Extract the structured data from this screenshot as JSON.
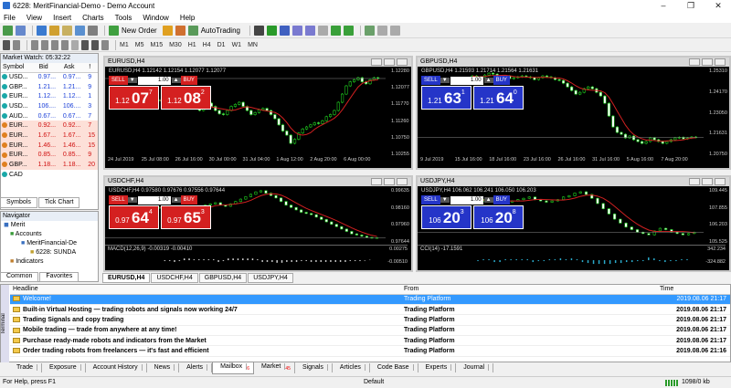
{
  "window": {
    "title": "6228: MeritFinancial-Demo - Demo Account"
  },
  "menu": [
    "File",
    "View",
    "Insert",
    "Charts",
    "Tools",
    "Window",
    "Help"
  ],
  "toolbar": {
    "new_order": "New Order",
    "autotrading": "AutoTrading"
  },
  "timeframes": [
    "M1",
    "M5",
    "M15",
    "M30",
    "H1",
    "H4",
    "D1",
    "W1",
    "MN"
  ],
  "market_watch": {
    "title": "Market Watch: 05:32:22",
    "columns": [
      "Symbol",
      "Bid",
      "Ask",
      "!"
    ],
    "rows": [
      {
        "symbol": "USD...",
        "bid": "0.97...",
        "ask": "0.97...",
        "spread": "9",
        "dot": "#1aa8a8",
        "bg": "#ffffff",
        "col": "#1a3fd8"
      },
      {
        "symbol": "GBP...",
        "bid": "1.21...",
        "ask": "1.21...",
        "spread": "9",
        "dot": "#1aa8a8",
        "bg": "#ffffff",
        "col": "#1a3fd8"
      },
      {
        "symbol": "EUR...",
        "bid": "1.12...",
        "ask": "1.12...",
        "spread": "1",
        "dot": "#1aa8a8",
        "bg": "#ffffff",
        "col": "#1a3fd8"
      },
      {
        "symbol": "USD...",
        "bid": "106....",
        "ask": "106....",
        "spread": "3",
        "dot": "#1aa8a8",
        "bg": "#ffffff",
        "col": "#1a3fd8"
      },
      {
        "symbol": "AUD...",
        "bid": "0.67...",
        "ask": "0.67...",
        "spread": "7",
        "dot": "#1aa8a8",
        "bg": "#ffffff",
        "col": "#1a3fd8"
      },
      {
        "symbol": "EUR...",
        "bid": "0.92...",
        "ask": "0.92...",
        "spread": "7",
        "dot": "#e08020",
        "bg": "#fde0d8",
        "col": "#d01010"
      },
      {
        "symbol": "EUR...",
        "bid": "1.67...",
        "ask": "1.67...",
        "spread": "15",
        "dot": "#e08020",
        "bg": "#fde0d8",
        "col": "#d01010"
      },
      {
        "symbol": "EUR...",
        "bid": "1.46...",
        "ask": "1.46...",
        "spread": "15",
        "dot": "#e08020",
        "bg": "#fde0d8",
        "col": "#d01010"
      },
      {
        "symbol": "EUR...",
        "bid": "0.85...",
        "ask": "0.85...",
        "spread": "9",
        "dot": "#e08020",
        "bg": "#fde0d8",
        "col": "#d01010"
      },
      {
        "symbol": "GBP...",
        "bid": "1.18...",
        "ask": "1.18...",
        "spread": "20",
        "dot": "#e08020",
        "bg": "#fde0d8",
        "col": "#d01010"
      },
      {
        "symbol": "CAD",
        "bid": "",
        "ask": "",
        "spread": "",
        "dot": "#1aa8a8",
        "bg": "#ffffff",
        "col": "#1a3fd8"
      }
    ],
    "tabs": [
      "Symbols",
      "Tick Chart"
    ]
  },
  "navigator": {
    "title": "Navigator",
    "items": [
      "Merit",
      "Accounts",
      "MeritFinancial-De",
      "6228: SUNDA",
      "Indicators"
    ],
    "tabs": [
      "Common",
      "Favorites"
    ]
  },
  "charts": [
    {
      "id": "eurusd",
      "title": "EURUSD,H4",
      "info": "EURUSD,H4  1.12142 1.12154 1.12077 1.12077",
      "sell_big": "07",
      "sell_pre": "1.12",
      "sell_sup": "7",
      "buy_big": "08",
      "buy_pre": "1.12",
      "buy_sup": "2",
      "lot": "1.00",
      "accent": "#d42020",
      "sell": "SELL",
      "buy": "BUY",
      "yticks": [
        "1.12280",
        "1.12077",
        "1.11770",
        "1.11260",
        "1.10750",
        "1.10255"
      ],
      "xticks": [
        "24 Jul 2019",
        "25 Jul 08:00",
        "26 Jul 16:00",
        "30 Jul 00:00",
        "31 Jul 04:00",
        "1 Aug 12:00",
        "2 Aug 20:00",
        "6 Aug 00:00"
      ],
      "close": [
        1.1155,
        1.115,
        1.1147,
        1.114,
        1.1145,
        1.1142,
        1.115,
        1.1145,
        1.1138,
        1.1135,
        1.113,
        1.114,
        1.1148,
        1.114,
        1.113,
        1.1122,
        1.112,
        1.113,
        1.114,
        1.1145,
        1.115,
        1.114,
        1.113,
        1.112,
        1.1125,
        1.1132,
        1.1135,
        1.113,
        1.112,
        1.111,
        1.1095,
        1.108,
        1.107,
        1.105,
        1.106,
        1.1075,
        1.1085,
        1.109,
        1.1095,
        1.11,
        1.1098,
        1.1105,
        1.1115,
        1.112,
        1.113,
        1.115,
        1.117,
        1.119,
        1.12,
        1.1205,
        1.121,
        1.12,
        1.1195,
        1.1205,
        1.121,
        1.1208
      ],
      "ylim": [
        1.10255,
        1.1228
      ]
    },
    {
      "id": "gbpusd",
      "title": "GBPUSD,H4",
      "info": "GBPUSD,H4  1.21593 1.21714 1.21564 1.21631",
      "sell_big": "63",
      "sell_pre": "1.21",
      "sell_sup": "1",
      "buy_big": "64",
      "buy_pre": "1.21",
      "buy_sup": "0",
      "lot": "1.00",
      "accent": "#2535c8",
      "sell": "SELL",
      "buy": "BUY",
      "yticks": [
        "1.25310",
        "1.24170",
        "1.23050",
        "1.21631",
        "1.20750"
      ],
      "xticks": [
        "9 Jul 2019",
        "15 Jul 16:00",
        "18 Jul 16:00",
        "23 Jul 16:00",
        "26 Jul 16:00",
        "31 Jul 16:00",
        "5 Aug 16:00",
        "7 Aug 20:00"
      ],
      "close": [
        1.25,
        1.249,
        1.2495,
        1.2505,
        1.2515,
        1.251,
        1.25,
        1.2495,
        1.25,
        1.2485,
        1.249,
        1.2495,
        1.25,
        1.2495,
        1.249,
        1.248,
        1.249,
        1.25,
        1.2495,
        1.249,
        1.248,
        1.2475,
        1.246,
        1.244,
        1.242,
        1.24,
        1.241,
        1.243,
        1.244,
        1.243,
        1.241,
        1.239,
        1.235,
        1.228,
        1.222,
        1.219,
        1.218,
        1.216,
        1.217,
        1.215,
        1.214,
        1.213,
        1.214,
        1.216,
        1.215,
        1.214,
        1.213,
        1.214,
        1.215,
        1.216,
        1.2163,
        1.2155,
        1.216,
        1.2165,
        1.2163
      ],
      "ylim": [
        1.2075,
        1.2531
      ]
    },
    {
      "id": "usdchf",
      "title": "USDCHF,H4",
      "info": "USDCHF,H4  0.97580 0.97676 0.97556 0.97644",
      "sell_big": "64",
      "sell_pre": "0.97",
      "sell_sup": "4",
      "buy_big": "65",
      "buy_pre": "0.97",
      "buy_sup": "3",
      "lot": "1.00",
      "accent": "#d42020",
      "sell": "SELL",
      "buy": "BUY",
      "ind": "MACD(12,26,9)  -0.00319 -0.00410",
      "yticks": [
        "0.99635",
        "0.98160",
        "0.97960",
        "0.97644"
      ],
      "xticks": [],
      "close": [
        0.989,
        0.9885,
        0.988,
        0.987,
        0.9865,
        0.9875,
        0.9885,
        0.989,
        0.9895,
        0.99,
        0.9905,
        0.991,
        0.99,
        0.9895,
        0.9905,
        0.9915,
        0.9925,
        0.9935,
        0.9945,
        0.9955,
        0.996,
        0.995,
        0.994,
        0.993,
        0.9915,
        0.99,
        0.989,
        0.988,
        0.987,
        0.9865,
        0.986,
        0.985,
        0.984,
        0.983,
        0.982,
        0.981,
        0.98,
        0.979,
        0.978,
        0.9775,
        0.977,
        0.9765,
        0.9762,
        0.9764
      ],
      "ylim": [
        0.975,
        0.99635
      ],
      "ind_ticks": [
        "0.00275",
        "-0.00510"
      ]
    },
    {
      "id": "usdjpy",
      "title": "USDJPY,H4",
      "info": "USDJPY,H4  106.062 106.241 106.050 106.203",
      "sell_big": "20",
      "sell_pre": "106",
      "sell_sup": "3",
      "buy_big": "20",
      "buy_pre": "106",
      "buy_sup": "8",
      "lot": "1.00",
      "accent": "#2535c8",
      "sell": "SELL",
      "buy": "BUY",
      "ind": "CCI(14)  -17.1591",
      "yticks": [
        "109.445",
        "107.855",
        "106.203",
        "105.525"
      ],
      "xticks": [],
      "close": [
        108.7,
        108.6,
        108.7,
        108.8,
        108.6,
        108.4,
        108.5,
        108.6,
        108.7,
        108.8,
        108.9,
        108.7,
        108.6,
        108.5,
        108.6,
        108.7,
        108.9,
        109.0,
        109.2,
        109.3,
        109.1,
        108.8,
        108.4,
        108.0,
        107.6,
        107.2,
        106.9,
        106.6,
        106.4,
        106.2,
        106.1,
        106.0,
        106.3,
        106.5,
        106.4,
        106.2,
        106.1,
        106.0,
        106.1,
        106.2
      ],
      "ylim": [
        105.525,
        109.445
      ],
      "ind_ticks": [
        "342.234",
        "-324.882"
      ]
    }
  ],
  "chart_tabs": [
    "EURUSD,H4",
    "USDCHF,H4",
    "GBPUSD,H4",
    "USDJPY,H4"
  ],
  "terminal": {
    "label": "Terminal",
    "columns": [
      "Headline",
      "From",
      "Time"
    ],
    "rows": [
      {
        "headline": "Welcome!",
        "from": "Trading Platform",
        "time": "2019.08.06 21:17",
        "bold": false,
        "sel": true
      },
      {
        "headline": "Built-in Virtual Hosting — trading robots and signals now working 24/7",
        "from": "Trading Platform",
        "time": "2019.08.06 21:17",
        "bold": true,
        "sel": false
      },
      {
        "headline": "Trading Signals and copy trading",
        "from": "Trading Platform",
        "time": "2019.08.06 21:17",
        "bold": true,
        "sel": false
      },
      {
        "headline": "Mobile trading — trade from anywhere at any time!",
        "from": "Trading Platform",
        "time": "2019.08.06 21:17",
        "bold": true,
        "sel": false
      },
      {
        "headline": "Purchase ready-made robots and indicators from the Market",
        "from": "Trading Platform",
        "time": "2019.08.06 21:17",
        "bold": true,
        "sel": false
      },
      {
        "headline": "Order trading robots from freelancers — it's fast and efficient",
        "from": "Trading Platform",
        "time": "2019.08.06 21:16",
        "bold": true,
        "sel": false
      }
    ],
    "tabs": [
      {
        "label": "Trade",
        "sub": ""
      },
      {
        "label": "Exposure",
        "sub": ""
      },
      {
        "label": "Account History",
        "sub": ""
      },
      {
        "label": "News",
        "sub": ""
      },
      {
        "label": "Alerts",
        "sub": ""
      },
      {
        "label": "Mailbox",
        "sub": "6"
      },
      {
        "label": "Market",
        "sub": "45"
      },
      {
        "label": "Signals",
        "sub": ""
      },
      {
        "label": "Articles",
        "sub": ""
      },
      {
        "label": "Code Base",
        "sub": ""
      },
      {
        "label": "Experts",
        "sub": ""
      },
      {
        "label": "Journal",
        "sub": ""
      }
    ]
  },
  "status": {
    "help": "For Help, press F1",
    "profile": "Default",
    "traffic": "1098/0 kb"
  }
}
